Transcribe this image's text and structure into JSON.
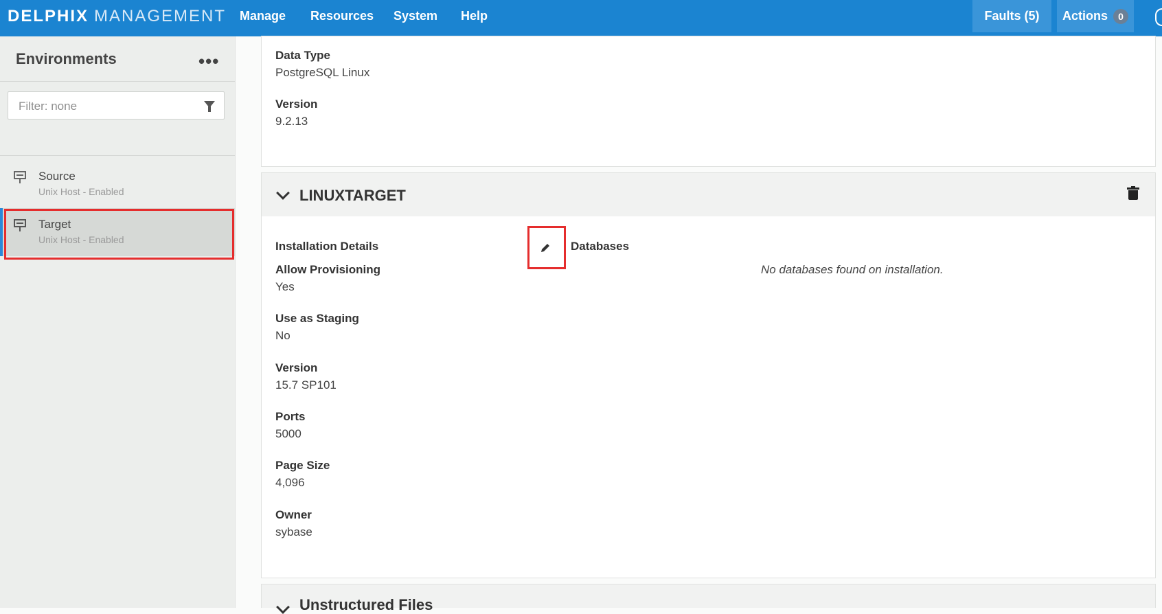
{
  "header": {
    "brand_strong": "DELPHIX",
    "brand_light": "MANAGEMENT",
    "nav": [
      "Manage",
      "Resources",
      "System",
      "Help"
    ],
    "faults_label": "Faults (5)",
    "actions_label": "Actions",
    "actions_count": "0"
  },
  "sidebar": {
    "title": "Environments",
    "more_label": "•••",
    "filter_placeholder": "Filter: none",
    "environments": [
      {
        "name": "Source",
        "subtitle": "Unix Host - Enabled"
      },
      {
        "name": "Target",
        "subtitle": "Unix Host - Enabled"
      }
    ]
  },
  "top_card": {
    "fields": [
      {
        "label": "Data Type",
        "value": "PostgreSQL Linux"
      },
      {
        "label": "Version",
        "value": "9.2.13"
      }
    ]
  },
  "installation": {
    "title": "LINUXTARGET",
    "details_label": "Installation Details",
    "databases_label": "Databases",
    "no_databases": "No databases found on installation.",
    "fields": [
      {
        "label": "Allow Provisioning",
        "value": "Yes"
      },
      {
        "label": "Use as Staging",
        "value": "No"
      },
      {
        "label": "Version",
        "value": "15.7 SP101"
      },
      {
        "label": "Ports",
        "value": "5000"
      },
      {
        "label": "Page Size",
        "value": "4,096"
      },
      {
        "label": "Owner",
        "value": "sybase"
      }
    ]
  },
  "next_section": {
    "title": "Unstructured Files"
  },
  "colors": {
    "topbar": "#1b84d1",
    "highlight": "#e52d2d",
    "selected_accent": "#2b88d8"
  }
}
